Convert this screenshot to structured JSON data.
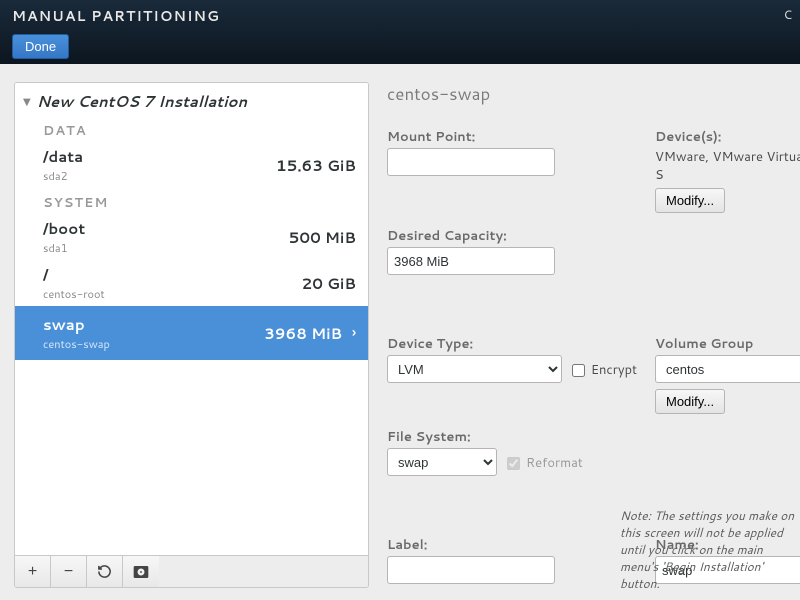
{
  "header": {
    "title": "MANUAL PARTITIONING",
    "done": "Done",
    "lang_top": "C",
    "lang_bottom": ""
  },
  "left": {
    "install_title": "New CentOS 7 Installation",
    "sections": {
      "data": "DATA",
      "system": "SYSTEM"
    },
    "rows": {
      "data0": {
        "mount": "/data",
        "device": "sda2",
        "size": "15.63 GiB"
      },
      "sys0": {
        "mount": "/boot",
        "device": "sda1",
        "size": "500 MiB"
      },
      "sys1": {
        "mount": "/",
        "device": "centos-root",
        "size": "20 GiB"
      },
      "sys2": {
        "mount": "swap",
        "device": "centos-swap",
        "size": "3968 MiB"
      }
    },
    "toolbar": {
      "add": "+",
      "remove": "−",
      "reload": "↻",
      "disk": "disk"
    }
  },
  "right": {
    "title": "centos-swap",
    "labels": {
      "mount_point": "Mount Point:",
      "desired_capacity": "Desired Capacity:",
      "device_type": "Device Type:",
      "file_system": "File System:",
      "label": "Label:",
      "devices": "Device(s):",
      "volume_group": "Volume Group",
      "name": "Name:",
      "encrypt": "Encrypt",
      "reformat": "Reformat",
      "modify": "Modify..."
    },
    "values": {
      "mount_point": "",
      "desired_capacity": "3968 MiB",
      "device_type": "LVM",
      "file_system": "swap",
      "label": "",
      "device_text": "VMware, VMware Virtual S",
      "volume_group": "centos",
      "name": "swap"
    },
    "note": "Note:  The settings you make on this screen will not be applied until you click on the main menu's 'Begin Installation' button."
  }
}
